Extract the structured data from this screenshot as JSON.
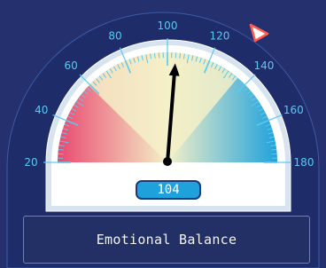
{
  "gauge": {
    "title": "Emotional Balance",
    "value": 104,
    "value_text": "104",
    "min": 20,
    "max": 180,
    "scale_labels": [
      "20",
      "40",
      "60",
      "80",
      "100",
      "120",
      "140",
      "160",
      "180"
    ],
    "colors": {
      "background": "#25306f",
      "bezel": "#1e2d6a",
      "red_zone": "#e9496f",
      "neutral_zone": "#f4f0c8",
      "blue_zone": "#1fa2dc",
      "tick": "#5ac8f0",
      "needle": "#000000",
      "marker": "#ff5c50"
    }
  }
}
